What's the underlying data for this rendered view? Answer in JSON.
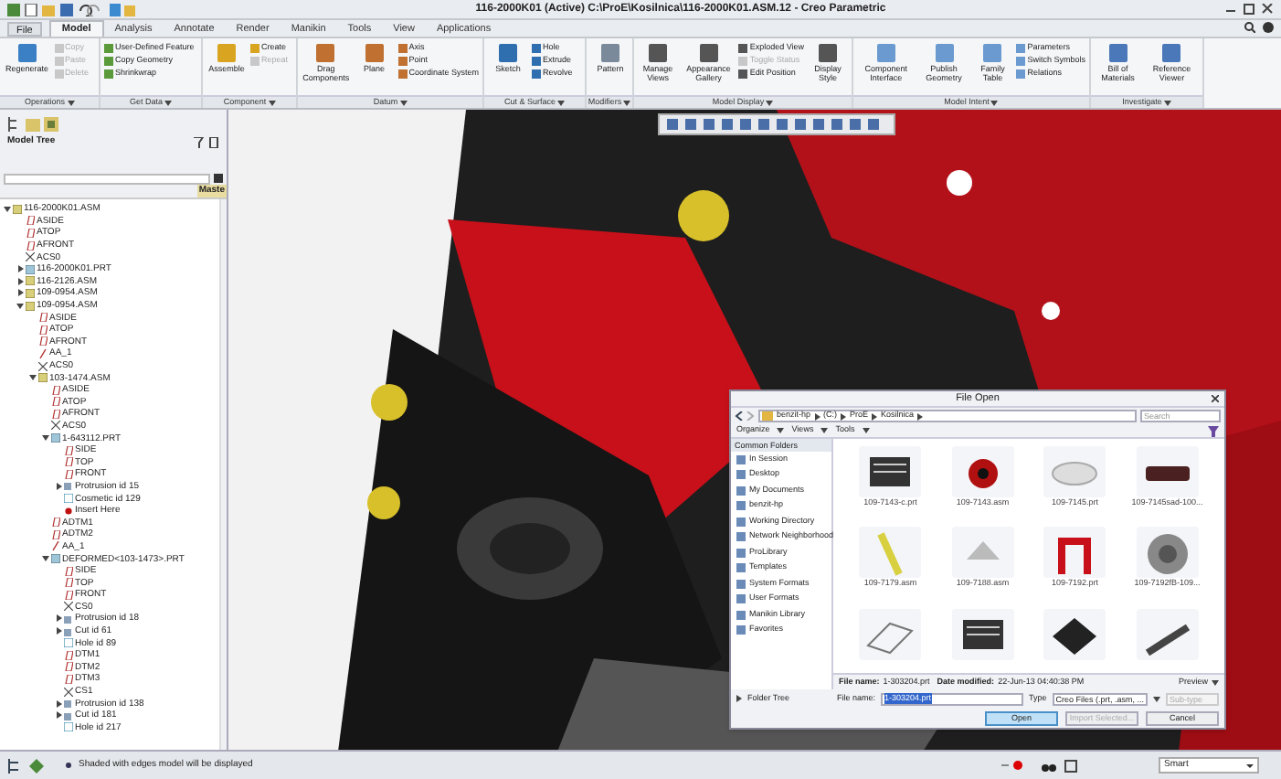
{
  "window": {
    "title": "116-2000K01 (Active) C:\\ProE\\Kosilnica\\116-2000K01.ASM.12 - Creo Parametric"
  },
  "tabs": [
    {
      "label": "File",
      "selected": false
    },
    {
      "label": "Model",
      "selected": true
    },
    {
      "label": "Analysis",
      "selected": false
    },
    {
      "label": "Annotate",
      "selected": false
    },
    {
      "label": "Render",
      "selected": false
    },
    {
      "label": "Manikin",
      "selected": false
    },
    {
      "label": "Tools",
      "selected": false
    },
    {
      "label": "View",
      "selected": false
    },
    {
      "label": "Applications",
      "selected": false
    }
  ],
  "ribbon_groups": [
    {
      "label": "Operations",
      "items": [
        {
          "label": "Regenerate",
          "kind": "large",
          "disabled": false
        },
        {
          "label": "Copy",
          "kind": "small",
          "disabled": true
        },
        {
          "label": "Paste",
          "kind": "small",
          "disabled": true
        },
        {
          "label": "Delete",
          "kind": "small",
          "disabled": true
        }
      ]
    },
    {
      "label": "Get Data",
      "items": [
        {
          "label": "User-Defined Feature",
          "kind": "small",
          "disabled": false
        },
        {
          "label": "Copy Geometry",
          "kind": "small",
          "disabled": false
        },
        {
          "label": "Shrinkwrap",
          "kind": "small",
          "disabled": false
        }
      ]
    },
    {
      "label": "Component",
      "items": [
        {
          "label": "Assemble",
          "kind": "large",
          "disabled": false
        },
        {
          "label": "Create",
          "kind": "small",
          "disabled": false
        },
        {
          "label": "Repeat",
          "kind": "small",
          "disabled": true
        }
      ]
    },
    {
      "label": "Datum",
      "items": [
        {
          "label": "Drag Components",
          "kind": "large",
          "disabled": false
        },
        {
          "label": "Plane",
          "kind": "large",
          "disabled": false
        },
        {
          "label": "Axis",
          "kind": "small",
          "disabled": false
        },
        {
          "label": "Point",
          "kind": "small",
          "disabled": false
        },
        {
          "label": "Coordinate System",
          "kind": "small",
          "disabled": false
        }
      ]
    },
    {
      "label": "Cut & Surface",
      "items": [
        {
          "label": "Sketch",
          "kind": "large",
          "disabled": false
        },
        {
          "label": "Hole",
          "kind": "small",
          "disabled": false
        },
        {
          "label": "Extrude",
          "kind": "small",
          "disabled": false
        },
        {
          "label": "Revolve",
          "kind": "small",
          "disabled": false
        }
      ]
    },
    {
      "label": "Modifiers",
      "items": [
        {
          "label": "Pattern",
          "kind": "large",
          "disabled": false
        }
      ]
    },
    {
      "label": "Model Display",
      "items": [
        {
          "label": "Manage Views",
          "kind": "large",
          "disabled": false
        },
        {
          "label": "Appearance Gallery",
          "kind": "large",
          "disabled": false
        },
        {
          "label": "Exploded View",
          "kind": "small",
          "disabled": false
        },
        {
          "label": "Toggle Status",
          "kind": "small",
          "disabled": true
        },
        {
          "label": "Edit Position",
          "kind": "small",
          "disabled": false
        },
        {
          "label": "Display Style",
          "kind": "large",
          "disabled": false
        }
      ]
    },
    {
      "label": "Model Intent",
      "items": [
        {
          "label": "Component Interface",
          "kind": "large",
          "disabled": false
        },
        {
          "label": "Publish Geometry",
          "kind": "large",
          "disabled": false
        },
        {
          "label": "Family Table",
          "kind": "large",
          "disabled": false
        },
        {
          "label": "Parameters",
          "kind": "small",
          "disabled": false
        },
        {
          "label": "Switch Symbols",
          "kind": "small",
          "disabled": false
        },
        {
          "label": "Relations",
          "kind": "small",
          "disabled": false
        }
      ]
    },
    {
      "label": "Investigate",
      "items": [
        {
          "label": "Bill of Materials",
          "kind": "large",
          "disabled": false
        },
        {
          "label": "Reference Viewer",
          "kind": "large",
          "disabled": false
        }
      ]
    }
  ],
  "model_tree": {
    "title": "Model Tree",
    "column_header": "Maste",
    "nodes": [
      {
        "label": "116-2000K01.ASM",
        "kind": "asm",
        "expanded": true,
        "children": [
          {
            "label": "ASIDE",
            "kind": "plane"
          },
          {
            "label": "ATOP",
            "kind": "plane"
          },
          {
            "label": "AFRONT",
            "kind": "plane"
          },
          {
            "label": "ACS0",
            "kind": "csys"
          },
          {
            "label": "116-2000K01.PRT",
            "kind": "prt",
            "expanded": false
          },
          {
            "label": "116-2126.ASM",
            "kind": "asm",
            "expanded": false
          },
          {
            "label": "109-0954.ASM",
            "kind": "asm",
            "expanded": false
          },
          {
            "label": "109-0954.ASM",
            "kind": "asm",
            "expanded": true,
            "children": [
              {
                "label": "ASIDE",
                "kind": "plane"
              },
              {
                "label": "ATOP",
                "kind": "plane"
              },
              {
                "label": "AFRONT",
                "kind": "plane"
              },
              {
                "label": "AA_1",
                "kind": "axis"
              },
              {
                "label": "ACS0",
                "kind": "csys"
              },
              {
                "label": "103-1474.ASM",
                "kind": "asm",
                "expanded": true,
                "children": [
                  {
                    "label": "ASIDE",
                    "kind": "plane"
                  },
                  {
                    "label": "ATOP",
                    "kind": "plane"
                  },
                  {
                    "label": "AFRONT",
                    "kind": "plane"
                  },
                  {
                    "label": "ACS0",
                    "kind": "csys"
                  },
                  {
                    "label": "1-643112.PRT",
                    "kind": "prt",
                    "expanded": true,
                    "children": [
                      {
                        "label": "SIDE",
                        "kind": "plane"
                      },
                      {
                        "label": "TOP",
                        "kind": "plane"
                      },
                      {
                        "label": "FRONT",
                        "kind": "plane"
                      },
                      {
                        "label": "Protrusion id 15",
                        "kind": "feature",
                        "expanded": false
                      },
                      {
                        "label": "Cosmetic id 129",
                        "kind": "cosmetic"
                      },
                      {
                        "label": "Insert Here",
                        "kind": "insert"
                      }
                    ]
                  },
                  {
                    "label": "ADTM1",
                    "kind": "plane"
                  },
                  {
                    "label": "ADTM2",
                    "kind": "plane"
                  },
                  {
                    "label": "AA_1",
                    "kind": "axis"
                  },
                  {
                    "label": "DEFORMED<103-1473>.PRT",
                    "kind": "prt",
                    "expanded": true,
                    "children": [
                      {
                        "label": "SIDE",
                        "kind": "plane"
                      },
                      {
                        "label": "TOP",
                        "kind": "plane"
                      },
                      {
                        "label": "FRONT",
                        "kind": "plane"
                      },
                      {
                        "label": "CS0",
                        "kind": "csys"
                      },
                      {
                        "label": "Protrusion id 18",
                        "kind": "feature",
                        "expanded": false
                      },
                      {
                        "label": "Cut id 61",
                        "kind": "feature",
                        "expanded": false
                      },
                      {
                        "label": "Hole id 89",
                        "kind": "cosmetic"
                      },
                      {
                        "label": "DTM1",
                        "kind": "plane"
                      },
                      {
                        "label": "DTM2",
                        "kind": "plane"
                      },
                      {
                        "label": "DTM3",
                        "kind": "plane"
                      },
                      {
                        "label": "CS1",
                        "kind": "csys"
                      },
                      {
                        "label": "Protrusion id 138",
                        "kind": "feature",
                        "expanded": false
                      },
                      {
                        "label": "Cut id 181",
                        "kind": "feature",
                        "expanded": false
                      },
                      {
                        "label": "Hole id 217",
                        "kind": "cosmetic"
                      }
                    ]
                  }
                ]
              }
            ]
          }
        ]
      }
    ]
  },
  "file_dialog": {
    "title": "File Open",
    "path": [
      "benzit-hp",
      "(C:)",
      "ProE",
      "Kosilnica"
    ],
    "search": {
      "placeholder": "Search"
    },
    "toolbar": [
      "Organize",
      "Views",
      "Tools"
    ],
    "sidebar_title": "Common Folders",
    "folders": [
      "In Session",
      "Desktop",
      "My Documents",
      "benzit-hp",
      "Working Directory",
      "Network Neighborhood",
      "ProLibrary",
      "Templates",
      "System Formats",
      "User Formats",
      "Manikin Library",
      "Favorites"
    ],
    "files": [
      {
        "name": "109-7143-c.prt",
        "kind": "block"
      },
      {
        "name": "109-7143.asm",
        "kind": "wheel"
      },
      {
        "name": "109-7145.prt",
        "kind": "cap"
      },
      {
        "name": "109-7145sad-100...",
        "kind": "box"
      },
      {
        "name": "109-7179.asm",
        "kind": "rod"
      },
      {
        "name": "109-7188.asm",
        "kind": "bracket"
      },
      {
        "name": "109-7192.prt",
        "kind": "hook"
      },
      {
        "name": "109-7192fB-109...",
        "kind": "disc"
      },
      {
        "kind": "frame"
      },
      {
        "kind": "block"
      },
      {
        "kind": "plate"
      },
      {
        "kind": "bar"
      }
    ],
    "info_name_label": "File name:",
    "info_name": "1-303204.prt",
    "info_date_label": "Date modified:",
    "info_date": "22-Jun-13 04:40:38 PM",
    "preview": "Preview",
    "file_name_label": "File name:",
    "file_name": "1-303204.prt",
    "type_label": "Type",
    "type": "Creo Files (.prt, .asm, ...",
    "subtype_label": "Sub-type",
    "buttons": [
      {
        "label": "Open",
        "kind": "primary",
        "disabled": false
      },
      {
        "label": "Import Selected...",
        "kind": "normal",
        "disabled": true
      },
      {
        "label": "Cancel",
        "kind": "normal",
        "disabled": false
      }
    ],
    "folder_tree": "Folder Tree"
  },
  "status_bar": {
    "message": "Shaded with edges model will be displayed",
    "filter": "Smart"
  }
}
